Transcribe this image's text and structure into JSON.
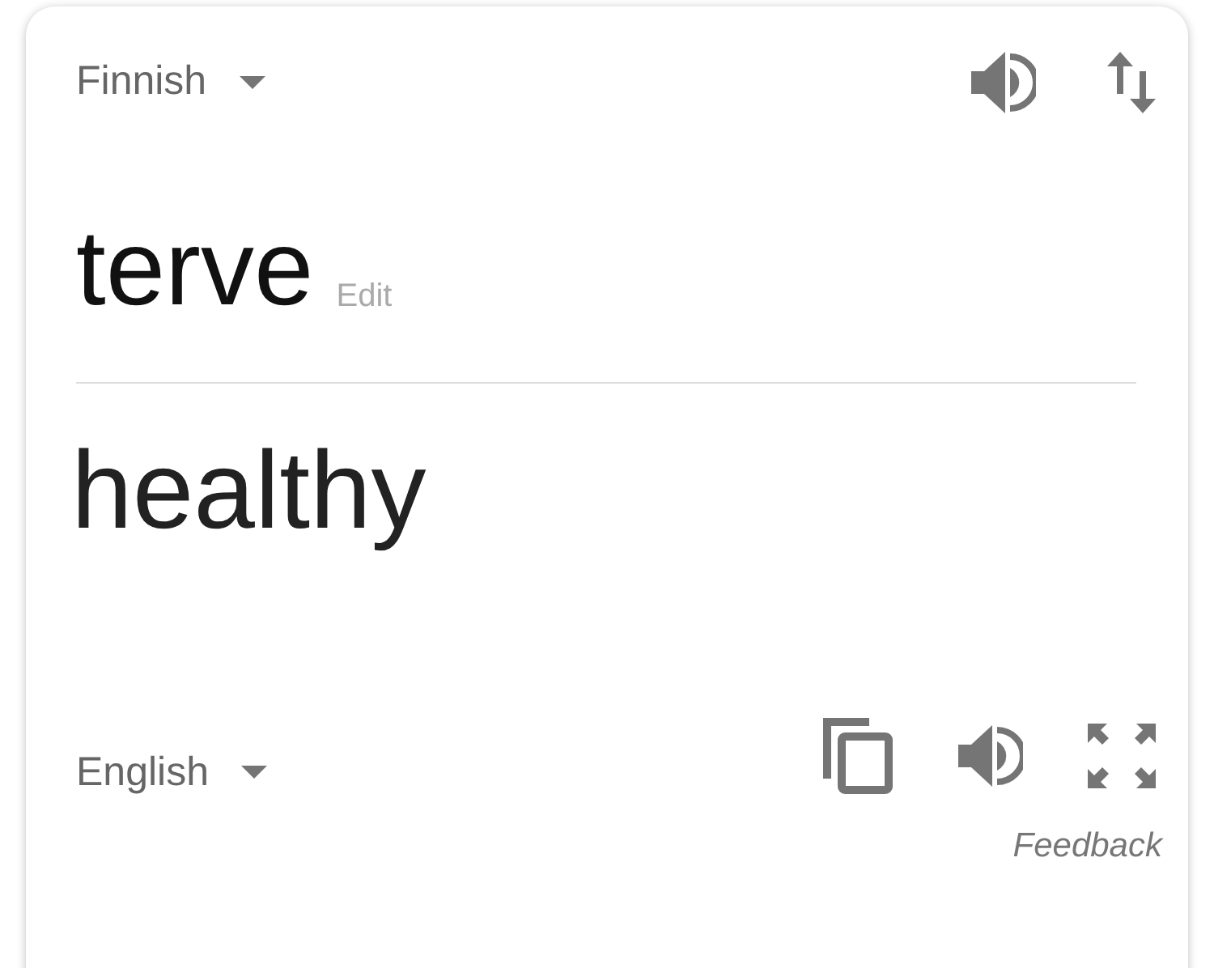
{
  "source": {
    "language": "Finnish",
    "text": "terve",
    "edit_link": "Edit"
  },
  "result": {
    "language": "English",
    "text": "healthy"
  },
  "feedback_link": "Feedback"
}
